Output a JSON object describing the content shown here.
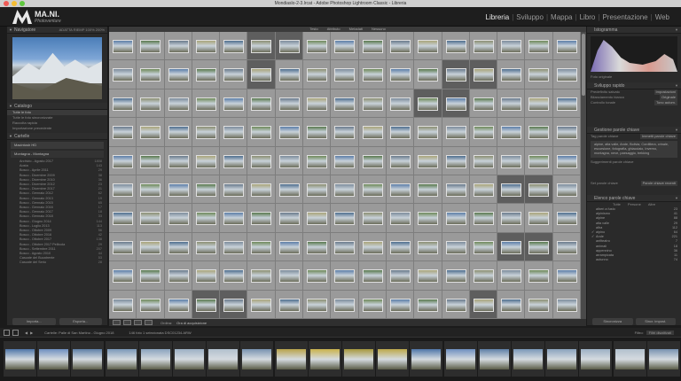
{
  "window": {
    "title": "Mondiaslo-2-3.lrcat - Adobe Photoshop Lightroom Classic - Libreria"
  },
  "identity": {
    "name": "MA.NI.",
    "tagline": "Photoventure"
  },
  "modules": [
    "Libreria",
    "Sviluppo",
    "Mappa",
    "Libro",
    "Presentazione",
    "Web"
  ],
  "left": {
    "navigator": {
      "title": "Navigatore",
      "opts": "ADATTA  RIEMP  100%  200%"
    },
    "catalog": {
      "title": "Catalogo",
      "items": [
        {
          "label": "Tutte le foto",
          "count": ""
        },
        {
          "label": "Tutte le foto sincronizzate",
          "count": ""
        },
        {
          "label": "Raccolta rapida",
          "count": ""
        },
        {
          "label": "Importazione precedente",
          "count": ""
        }
      ]
    },
    "folders": {
      "title": "Cartelle",
      "drive": "Macintosh HD",
      "volume": "Montagna - Montagna",
      "items": [
        {
          "label": "Archivio - Agosto 2017",
          "count": "1808"
        },
        {
          "label": "Aosta",
          "count": "143"
        },
        {
          "label": "Bosco - Aprile 2011",
          "count": "29"
        },
        {
          "label": "Bosco - Dicembre 2009",
          "count": "38"
        },
        {
          "label": "Bosco - Dicembre 2010",
          "count": "36"
        },
        {
          "label": "Bosco - Dicembre 2012",
          "count": "23"
        },
        {
          "label": "Bosco - Dicembre 2017",
          "count": "21"
        },
        {
          "label": "Bosco - Gennaio 2012",
          "count": "62"
        },
        {
          "label": "Bosco - Gennaio 2013",
          "count": "19"
        },
        {
          "label": "Bosco - Gennaio 2015",
          "count": "65"
        },
        {
          "label": "Bosco - Gennaio 2016",
          "count": "17"
        },
        {
          "label": "Bosco - Gennaio 2017",
          "count": "18"
        },
        {
          "label": "Bosco - Gennaio 2018",
          "count": "33"
        },
        {
          "label": "Bosco - Giugno 2014",
          "count": "144"
        },
        {
          "label": "Bosco - Luglio 2013",
          "count": "113"
        },
        {
          "label": "Bosco - Ottobre 2009",
          "count": "56"
        },
        {
          "label": "Bosco - Ottobre 2016",
          "count": "42"
        },
        {
          "label": "Bosco - Ottobre 2017",
          "count": "138"
        },
        {
          "label": "Bosco - Ottobre 2017 Pellicola",
          "count": "29"
        },
        {
          "label": "Bosco - Settembre 2011",
          "count": "207"
        },
        {
          "label": "Bosco - Agosto 2010",
          "count": "44"
        },
        {
          "label": "Cascate del Bucatrente",
          "count": "53"
        },
        {
          "label": "Cascate del Serio",
          "count": "28"
        }
      ]
    },
    "buttons": {
      "import": "Importa...",
      "export": "Esporta..."
    }
  },
  "center": {
    "filter": [
      "Testo",
      "Attributo",
      "Metadati",
      "Nessuno"
    ],
    "grid_rows": 10,
    "grid_cols": 17,
    "dark_cells": [
      5,
      6,
      22,
      29,
      30,
      45,
      46,
      99,
      100,
      133,
      134,
      156,
      157,
      166,
      186,
      187
    ],
    "thumb_colors": [
      "#5d7fa8",
      "#6f8a5a",
      "#7c8c9c",
      "#8b8f72",
      "#4e6e8e",
      "#a9a57a",
      "#6a7b8c",
      "#59794e"
    ]
  },
  "toolbar": {
    "sort_label": "Ordina:",
    "sort_value": "Ora di acquisizione"
  },
  "right": {
    "histogram": {
      "title": "Istogramma",
      "note": "Foto originale"
    },
    "quick_develop": {
      "title": "Sviluppo rapido",
      "rows": [
        {
          "label": "Predefinito salvato",
          "value": "Impostazioni"
        },
        {
          "label": "Bilanciamento bianco",
          "value": "Originale"
        },
        {
          "label": "Controllo tonale",
          "value": "Tono autom."
        }
      ]
    },
    "keywording": {
      "title": "Gestione parole chiave",
      "tags_label": "Tag parole chiave",
      "tags_mode": "Immetti parole chiave",
      "text": "alpine, alta valle, Ande, Bolivia, Cordillera, crinale, escursione, fotografia, ghiacciaio, Inverno, montagna, neve, paesaggio, trekking",
      "suggest": "Suggerimenti parole chiave",
      "set_label": "Set parole chiave",
      "set_value": "Parole chiave recenti"
    },
    "keyword_list": {
      "title": "Elenco parole chiave",
      "tabs": [
        "Tutte",
        "Persone",
        "Altre"
      ],
      "items": [
        {
          "label": "alberi a fusto",
          "count": "23",
          "checked": false
        },
        {
          "label": "alpinismo",
          "count": "41",
          "checked": false
        },
        {
          "label": "alpine",
          "count": "88",
          "checked": false
        },
        {
          "label": "alta valle",
          "count": "29",
          "checked": false
        },
        {
          "label": "alba",
          "count": "112",
          "checked": false
        },
        {
          "label": "alpino",
          "count": "64",
          "checked": true
        },
        {
          "label": "Ande",
          "count": "221",
          "checked": true
        },
        {
          "label": "anfiteatro",
          "count": "7",
          "checked": false
        },
        {
          "label": "animali",
          "count": "18",
          "checked": false
        },
        {
          "label": "appennino",
          "count": "36",
          "checked": false
        },
        {
          "label": "arrampicata",
          "count": "11",
          "checked": false
        },
        {
          "label": "autunno",
          "count": "74",
          "checked": false
        }
      ]
    },
    "buttons": {
      "sync": "Sincronizza",
      "sync_settings": "Sincr. impost."
    }
  },
  "filmstrip": {
    "path": "Cartelle: Palle di San Martino - Giugno 2018",
    "info": "146 foto  1 selezionata  DSC01234.ARW",
    "filter": "Filtro:",
    "filter_value": "Filtri disattivati",
    "count": 20
  }
}
